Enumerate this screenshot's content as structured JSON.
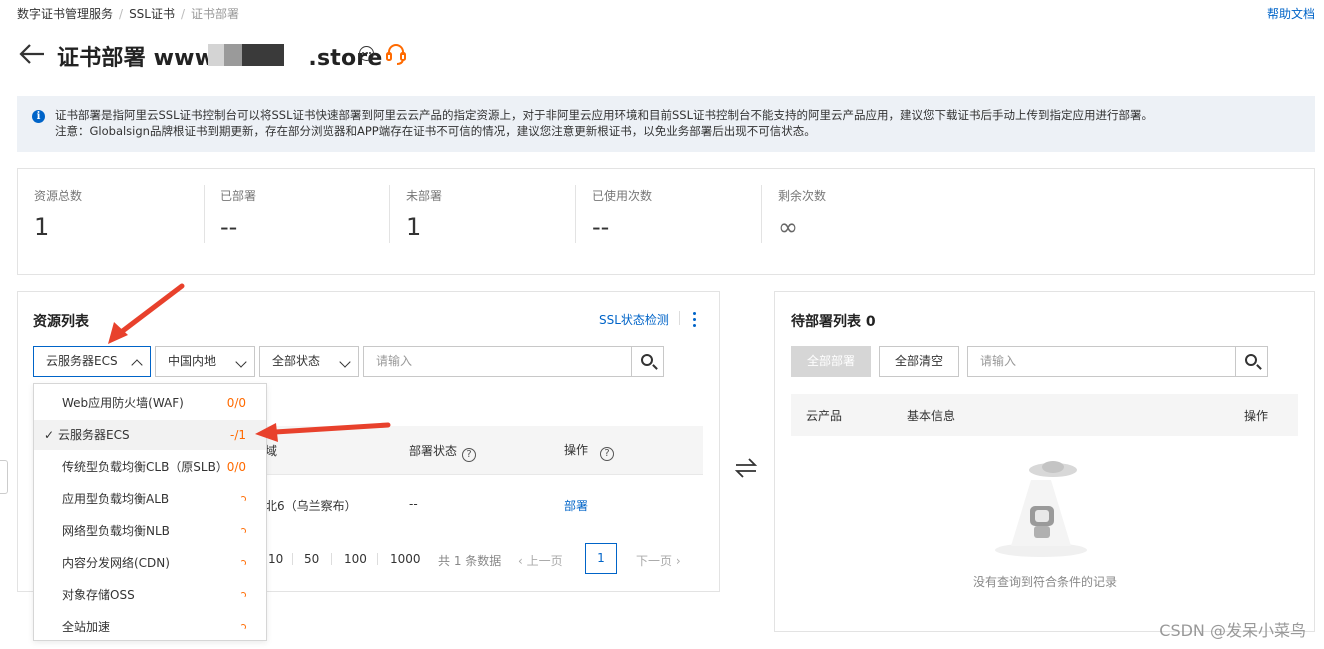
{
  "breadcrumb": [
    "数字证书管理服务",
    "SSL证书",
    "证书部署"
  ],
  "help_link": "帮助文档",
  "page": {
    "title_prefix": "证书部署 www.",
    "title_suffix": ".store"
  },
  "notice": {
    "line1": "证书部署是指阿里云SSL证书控制台可以将SSL证书快速部署到阿里云云产品的指定资源上，对于非阿里云应用环境和目前SSL证书控制台不能支持的阿里云产品应用，建议您下载证书后手动上传到指定应用进行部署。",
    "line2": "注意：Globalsign品牌根证书到期更新，存在部分浏览器和APP端存在证书不可信的情况，建议您注意更新根证书，以免业务部署后出现不可信状态。"
  },
  "stats": [
    {
      "label": "资源总数",
      "value": "1"
    },
    {
      "label": "已部署",
      "value": "--"
    },
    {
      "label": "未部署",
      "value": "1"
    },
    {
      "label": "已使用次数",
      "value": "--"
    },
    {
      "label": "剩余次数",
      "value": "∞"
    }
  ],
  "resource_panel": {
    "title": "资源列表",
    "ssl_check": "SSL状态检测",
    "product_select": "云服务器ECS",
    "region_select": "中国内地",
    "status_select": "全部状态",
    "search_placeholder": "请输入",
    "columns": {
      "region": "域",
      "deploy_status": "部署状态",
      "action": "操作"
    },
    "row": {
      "region": "北6（乌兰察布）",
      "deploy_status": "--",
      "action": "部署"
    },
    "pagination": {
      "sizes": [
        "10",
        "50",
        "100",
        "1000"
      ],
      "total": "共 1 条数据",
      "prev": "上一页",
      "current": "1",
      "next": "下一页"
    }
  },
  "dropdown": [
    {
      "label": "Web应用防火墙(WAF)",
      "count": "0/0"
    },
    {
      "label": "云服务器ECS",
      "count": "-/1",
      "selected": true
    },
    {
      "label": "传统型负载均衡CLB（原SLB）",
      "count": "0/0"
    },
    {
      "label": "应用型负载均衡ALB",
      "count": ""
    },
    {
      "label": "网络型负载均衡NLB",
      "count": ""
    },
    {
      "label": "内容分发网络(CDN)",
      "count": ""
    },
    {
      "label": "对象存储OSS",
      "count": ""
    },
    {
      "label": "全站加速",
      "count": ""
    }
  ],
  "pending_panel": {
    "title": "待部署列表 0",
    "deploy_all": "全部部署",
    "clear_all": "全部清空",
    "search_placeholder": "请输入",
    "columns": {
      "product": "云产品",
      "info": "基本信息",
      "action": "操作"
    },
    "empty_text": "没有查询到符合条件的记录"
  },
  "watermark": "CSDN @发呆小菜鸟",
  "colors": {
    "accent": "#0064c8",
    "orange": "#ff6a00",
    "arrow": "#e8412c"
  }
}
